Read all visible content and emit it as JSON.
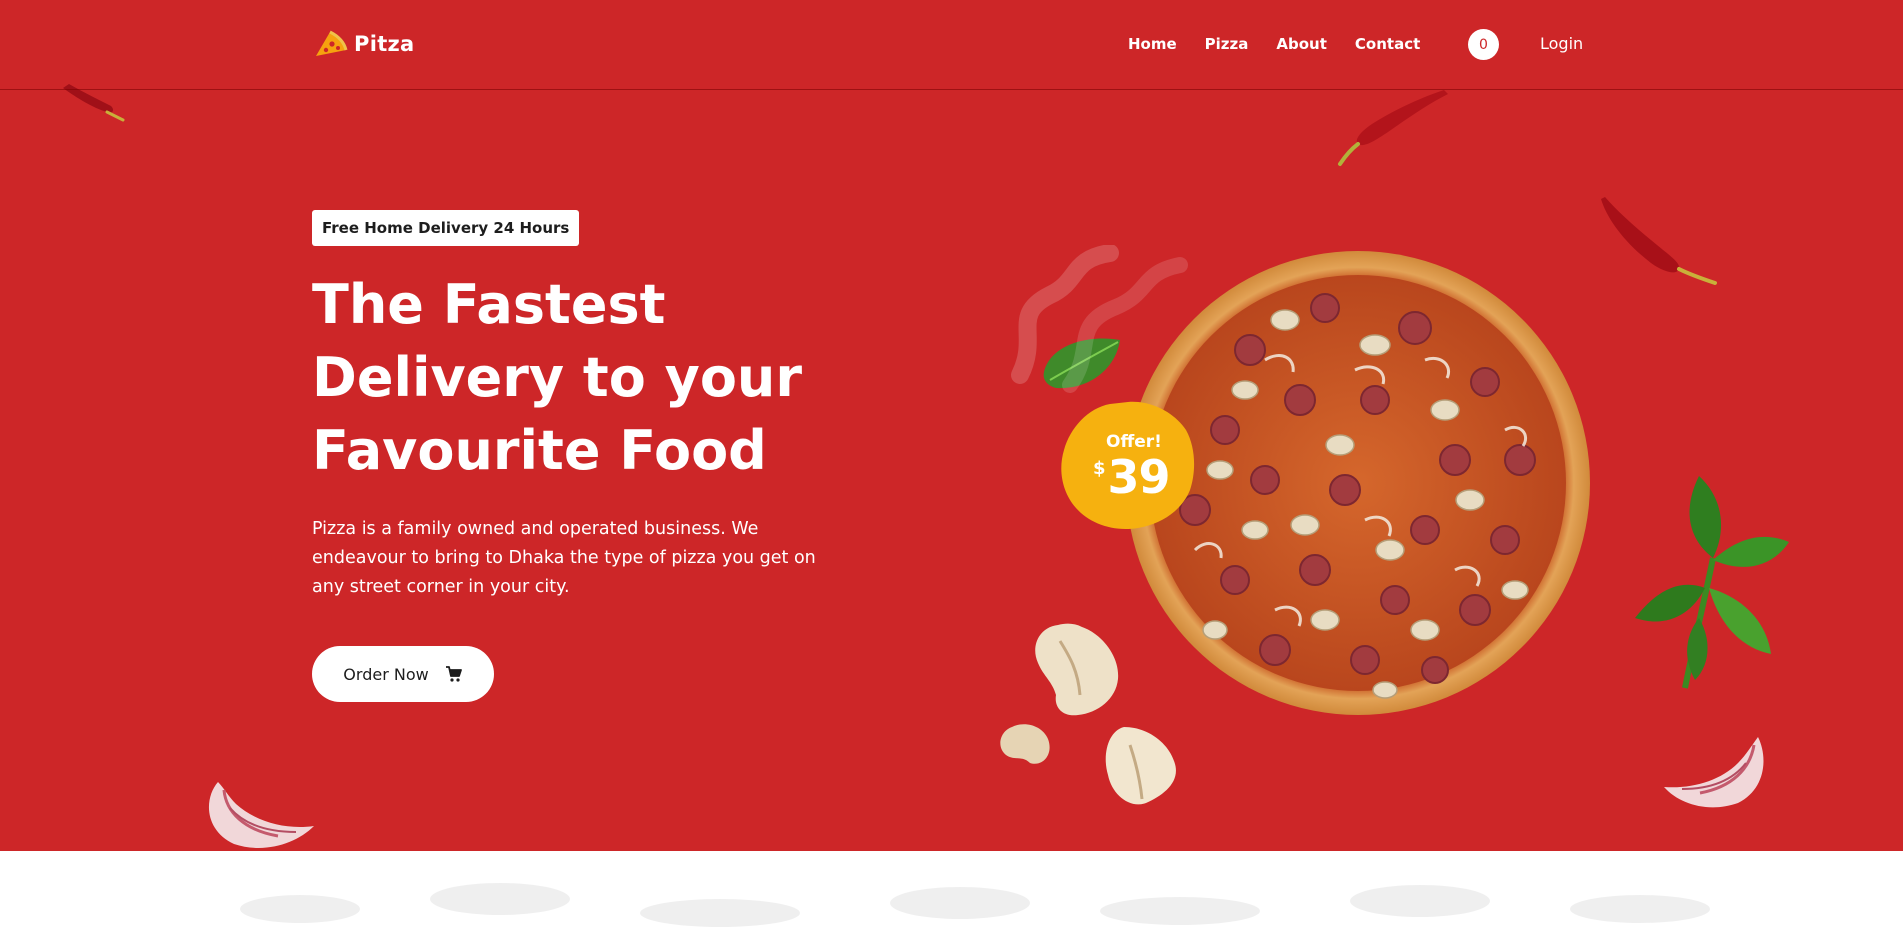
{
  "brand": {
    "name": "Pitza",
    "logo_icon": "pizza-slice-icon"
  },
  "nav": {
    "links": [
      "Home",
      "Pizza",
      "About",
      "Contact"
    ],
    "cart_count": "0",
    "login_label": "Login"
  },
  "hero": {
    "badge": "Free Home Delivery 24 Hours",
    "headline_lines": [
      "The Fastest",
      "Delivery to your",
      "Favourite Food"
    ],
    "description": "Pizza is a family owned and operated business. We endeavour to bring to Dhaka the type of pizza you get on any street corner in your city.",
    "order_button_label": "Order Now",
    "order_button_icon": "cart-icon"
  },
  "offer": {
    "label": "Offer!",
    "currency": "$",
    "price": "39"
  },
  "colors": {
    "hero_background": "#cd2628",
    "offer_yellow": "#f6b10f",
    "text_white": "#ffffff",
    "text_dark": "#1d1d1d"
  }
}
